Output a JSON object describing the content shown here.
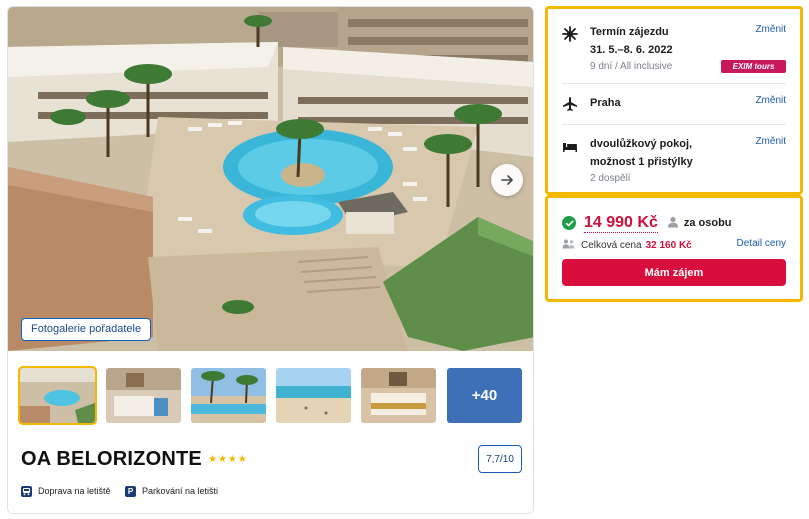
{
  "gallery": {
    "button_label": "Fotogalerie pořadatele",
    "more_count": "+40"
  },
  "hotel": {
    "name": "OA BELORIZONTE",
    "stars": 4,
    "stars_text": "★★★★",
    "rating": "7,7/10",
    "features": [
      {
        "icon": "bus-icon",
        "label": "Doprava na letiště"
      },
      {
        "icon": "parking-icon",
        "label": "Parkování na letišti"
      }
    ]
  },
  "trip": {
    "term_title": "Termín zájezdu",
    "term_dates": "31. 5.–8. 6. 2022",
    "term_sub": "9 dní / All inclusive",
    "operator": "EXIM tours",
    "departure": "Praha",
    "room_line1": "dvoulůžkový pokoj,",
    "room_line2": "možnost 1 přistýlky",
    "guests": "2 dospělí",
    "change_label": "Změnit"
  },
  "pricing": {
    "price": "14 990 Kč",
    "per_person": "za osobu",
    "total_label": "Celková cena",
    "total_value": "32 160 Kč",
    "detail_link": "Detail ceny",
    "cta": "Mám zájem"
  },
  "colors": {
    "accent_yellow": "#f5b800",
    "price_red": "#d0103a",
    "cta_red": "#d80f3c",
    "link_blue": "#1c5bb0",
    "operator_pink": "#c8185c"
  }
}
